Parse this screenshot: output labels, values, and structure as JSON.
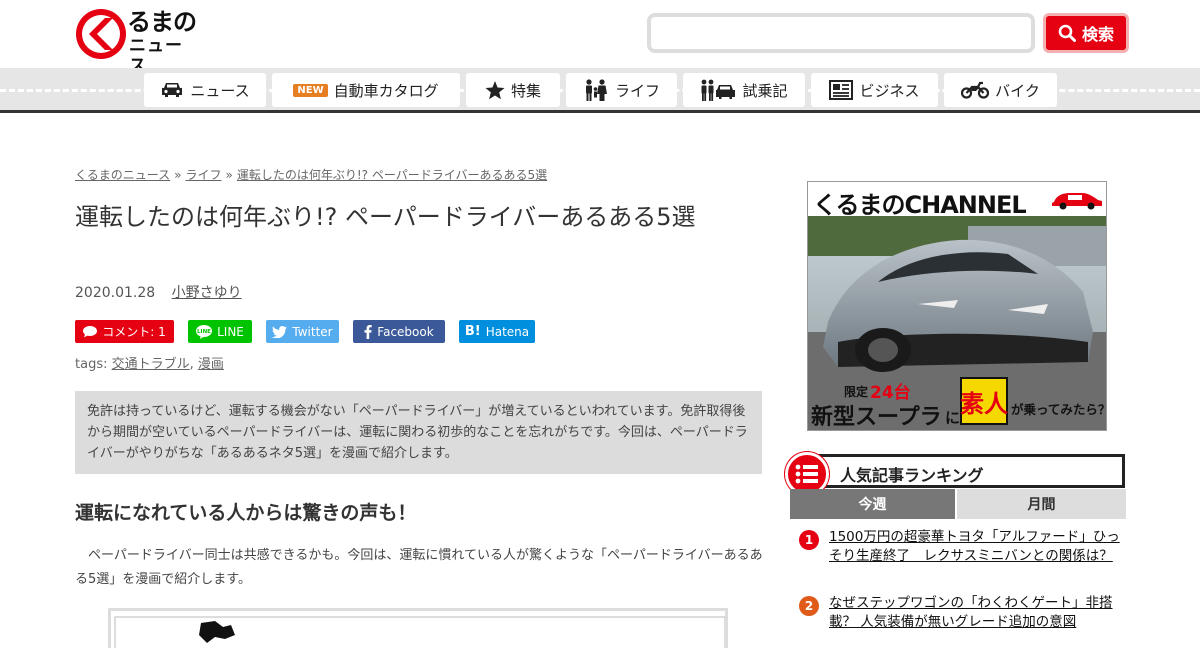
{
  "header": {
    "logo_line1": "るまの",
    "logo_line2": "ニュース",
    "search_placeholder": "",
    "search_button": "検索"
  },
  "nav": {
    "items": [
      {
        "label": "ニュース",
        "icon": "car-icon"
      },
      {
        "label": "自動車カタログ",
        "badge": "NEW"
      },
      {
        "label": "特集",
        "icon": "star-icon"
      },
      {
        "label": "ライフ",
        "icon": "family-icon"
      },
      {
        "label": "試乗記",
        "icon": "people-car-icon"
      },
      {
        "label": "ビジネス",
        "icon": "newspaper-icon"
      },
      {
        "label": "バイク",
        "icon": "motorcycle-icon"
      }
    ]
  },
  "breadcrumb": {
    "items": [
      "くるまのニュース",
      "ライフ",
      "運転したのは何年ぶり!? ペーパードライバーあるある5選"
    ],
    "separator": "»"
  },
  "article": {
    "title": "運転したのは何年ぶり!? ペーパードライバーあるある5選",
    "date": "2020.01.28",
    "author": "小野さゆり",
    "tags_label": "tags:",
    "tags": [
      "交通トラブル",
      "漫画"
    ],
    "tag_separator": ",",
    "lead": "免許は持っているけど、運転する機会がない「ペーパードライバー」が増えているといわれています。免許取得後から期間が空いているペーパードライバーは、運転に関わる初歩的なことを忘れがちです。今回は、ペーパードライバーがやりがちな「あるあるネタ5選」を漫画で紹介します。",
    "heading": "運転になれている人からは驚きの声も！",
    "body": "ペーパードライバー同士は共感できるかも。今回は、運転に慣れている人が驚くような「ペーパードライバーあるある5選」を漫画で紹介します。"
  },
  "share": {
    "buttons": [
      {
        "label": "コメント: 1",
        "color": "#e50012"
      },
      {
        "label": "LINE",
        "color": "#00c300"
      },
      {
        "label": "Twitter",
        "color": "#55acee"
      },
      {
        "label": "Facebook",
        "color": "#3b5998"
      },
      {
        "label": "Hatena",
        "color": "#008fde"
      }
    ]
  },
  "sidebar": {
    "banner": {
      "title": "くるまのCHANNEL",
      "limited": "限定",
      "count": "24台",
      "headline_a": "新型スープラ",
      "headline_b": "に",
      "headline_c": "素人",
      "headline_d": "が乗ってみたら？"
    },
    "ranking": {
      "title": "人気記事ランキング",
      "tabs": [
        "今週",
        "月間"
      ],
      "active_tab": "今週",
      "items": [
        {
          "rank": "1",
          "text": "1500万円の超豪華トヨタ「アルファード」ひっそり生産終了　レクサスミニバンとの関係は？",
          "color": "#e50012"
        },
        {
          "rank": "2",
          "text": "なぜステップワゴンの「わくわくゲート」非搭載？ 人気装備が無いグレード追加の意図",
          "color": "#e05a1a"
        }
      ]
    }
  },
  "colors": {
    "brand_red": "#e50012",
    "nav_bg": "#e6e6e6",
    "lead_bg": "#dcdcdc"
  }
}
